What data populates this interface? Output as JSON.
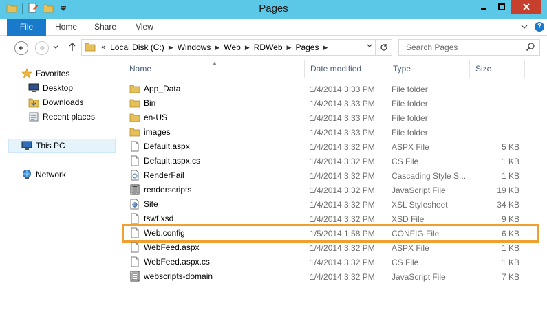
{
  "window": {
    "title": "Pages"
  },
  "ribbon": {
    "tabs": [
      "File",
      "Home",
      "Share",
      "View"
    ]
  },
  "address": {
    "prefix": "«",
    "crumbs": [
      "Local Disk (C:)",
      "Windows",
      "Web",
      "RDWeb",
      "Pages"
    ]
  },
  "search": {
    "placeholder": "Search Pages"
  },
  "navpane": {
    "favorites": "Favorites",
    "desktop": "Desktop",
    "downloads": "Downloads",
    "recent": "Recent places",
    "thispc": "This PC",
    "network": "Network"
  },
  "columns": {
    "name": "Name",
    "date": "Date modified",
    "type": "Type",
    "size": "Size"
  },
  "files": [
    {
      "name": "App_Data",
      "date": "1/4/2014 3:33 PM",
      "type": "File folder",
      "size": "",
      "icon": "folder-icon"
    },
    {
      "name": "Bin",
      "date": "1/4/2014 3:33 PM",
      "type": "File folder",
      "size": "",
      "icon": "folder-icon"
    },
    {
      "name": "en-US",
      "date": "1/4/2014 3:33 PM",
      "type": "File folder",
      "size": "",
      "icon": "folder-icon"
    },
    {
      "name": "images",
      "date": "1/4/2014 3:33 PM",
      "type": "File folder",
      "size": "",
      "icon": "folder-icon"
    },
    {
      "name": "Default.aspx",
      "date": "1/4/2014 3:32 PM",
      "type": "ASPX File",
      "size": "5 KB",
      "icon": "document-icon"
    },
    {
      "name": "Default.aspx.cs",
      "date": "1/4/2014 3:32 PM",
      "type": "CS File",
      "size": "1 KB",
      "icon": "document-icon"
    },
    {
      "name": "RenderFail",
      "date": "1/4/2014 3:32 PM",
      "type": "Cascading Style S...",
      "size": "1 KB",
      "icon": "stylesheet-icon"
    },
    {
      "name": "renderscripts",
      "date": "1/4/2014 3:32 PM",
      "type": "JavaScript File",
      "size": "19 KB",
      "icon": "script-icon"
    },
    {
      "name": "Site",
      "date": "1/4/2014 3:32 PM",
      "type": "XSL Stylesheet",
      "size": "34 KB",
      "icon": "xsl-icon"
    },
    {
      "name": "tswf.xsd",
      "date": "1/4/2014 3:32 PM",
      "type": "XSD File",
      "size": "9 KB",
      "icon": "document-icon"
    },
    {
      "name": "Web.config",
      "date": "1/5/2014 1:58 PM",
      "type": "CONFIG File",
      "size": "6 KB",
      "icon": "document-icon"
    },
    {
      "name": "WebFeed.aspx",
      "date": "1/4/2014 3:32 PM",
      "type": "ASPX File",
      "size": "1 KB",
      "icon": "document-icon"
    },
    {
      "name": "WebFeed.aspx.cs",
      "date": "1/4/2014 3:32 PM",
      "type": "CS File",
      "size": "1 KB",
      "icon": "document-icon"
    },
    {
      "name": "webscripts-domain",
      "date": "1/4/2014 3:32 PM",
      "type": "JavaScript File",
      "size": "7 KB",
      "icon": "script-icon"
    }
  ],
  "highlighted_file": "Web.config",
  "colors": {
    "titlebar": "#5ac8e6",
    "file_tab": "#1979ca",
    "highlight": "#f0a030",
    "folder": "#e8c05a"
  }
}
